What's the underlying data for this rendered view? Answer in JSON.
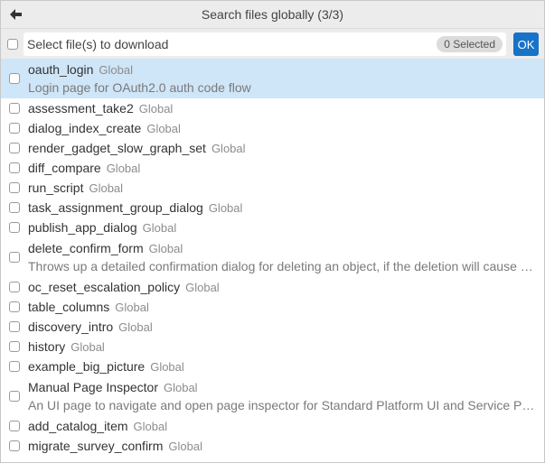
{
  "header": {
    "title": "Search files globally (3/3)",
    "back_icon": "arrow-left-icon"
  },
  "search": {
    "placeholder": "Select file(s) to download",
    "value": "",
    "selected_count": "0 Selected",
    "ok_label": "OK"
  },
  "colors": {
    "accent": "#1773c8",
    "selected_row": "#cfe5f8",
    "scope_text": "#8c8c8c"
  },
  "items": [
    {
      "name": "oauth_login",
      "scope": "Global",
      "description": "Login page for OAuth2.0 auth code flow",
      "selected": true
    },
    {
      "name": "assessment_take2",
      "scope": "Global",
      "description": ""
    },
    {
      "name": "dialog_index_create",
      "scope": "Global",
      "description": ""
    },
    {
      "name": "render_gadget_slow_graph_set",
      "scope": "Global",
      "description": ""
    },
    {
      "name": "diff_compare",
      "scope": "Global",
      "description": ""
    },
    {
      "name": "run_script",
      "scope": "Global",
      "description": ""
    },
    {
      "name": "task_assignment_group_dialog",
      "scope": "Global",
      "description": ""
    },
    {
      "name": "publish_app_dialog",
      "scope": "Global",
      "description": ""
    },
    {
      "name": "delete_confirm_form",
      "scope": "Global",
      "description": "Throws up a detailed confirmation dialog for deleting an object, if the deletion will cause del..."
    },
    {
      "name": "oc_reset_escalation_policy",
      "scope": "Global",
      "description": ""
    },
    {
      "name": "table_columns",
      "scope": "Global",
      "description": ""
    },
    {
      "name": "discovery_intro",
      "scope": "Global",
      "description": ""
    },
    {
      "name": "history",
      "scope": "Global",
      "description": ""
    },
    {
      "name": "example_big_picture",
      "scope": "Global",
      "description": ""
    },
    {
      "name": "Manual Page Inspector",
      "scope": "Global",
      "description": "An UI page to navigate and open page inspector for Standard Platform UI and Service Porta..."
    },
    {
      "name": "add_catalog_item",
      "scope": "Global",
      "description": ""
    },
    {
      "name": "migrate_survey_confirm",
      "scope": "Global",
      "description": ""
    }
  ]
}
